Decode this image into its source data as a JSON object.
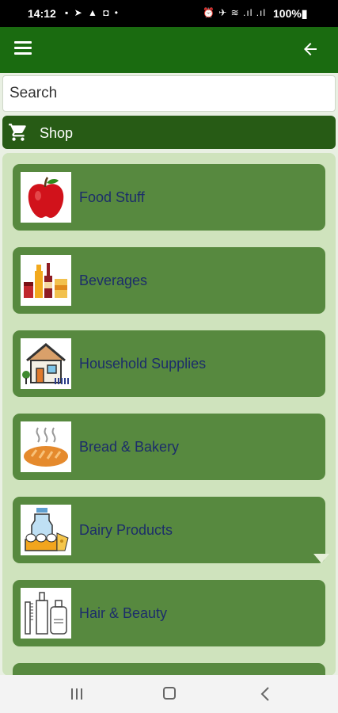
{
  "status_bar": {
    "time": "14:12",
    "left_icons": "▪ ➤ ▲ ◘ •",
    "right_icons": "⏰ ✈ ≋ .ıl .ıl",
    "battery": "100%▮"
  },
  "app_bar": {
    "menu_icon": "hamburger-menu-icon",
    "back_icon": "arrow-left-icon",
    "color": "#1a6b10"
  },
  "search": {
    "placeholder": "Search",
    "value": ""
  },
  "shop_header": {
    "label": "Shop",
    "icon": "shopping-cart-icon",
    "color": "#275b15"
  },
  "categories": [
    {
      "label": "Food Stuff",
      "icon": "apple-icon"
    },
    {
      "label": "Beverages",
      "icon": "beverages-icon"
    },
    {
      "label": "Household Supplies",
      "icon": "house-icon"
    },
    {
      "label": "Bread & Bakery",
      "icon": "bread-icon"
    },
    {
      "label": "Dairy Products",
      "icon": "dairy-icon"
    },
    {
      "label": "Hair & Beauty",
      "icon": "beauty-icon"
    }
  ],
  "colors": {
    "card": "#57893f",
    "panel": "#cfe3bd",
    "label_text": "#1c2d6a"
  }
}
